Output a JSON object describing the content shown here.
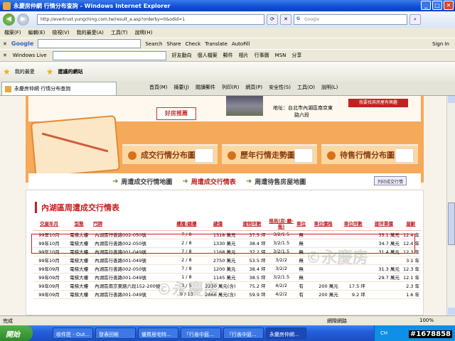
{
  "window": {
    "title": "永慶房仲網 行情分布查詢 - Windows Internet Explorer"
  },
  "address": {
    "url": "http://evertrust.yungching.com.tw/result_a.asp?orderby=0&odid=1",
    "search_placeholder": "Google"
  },
  "menu": [
    "檔案(F)",
    "編輯(E)",
    "檢視(V)",
    "我的最愛(A)",
    "工具(T)",
    "說明(H)"
  ],
  "google_toolbar": {
    "label": "Google",
    "search": "Search",
    "items": [
      "Share",
      "Check",
      "Translate",
      "AutoFill",
      "Sign In"
    ]
  },
  "wl_toolbar": {
    "label": "Windows Live",
    "items": [
      "好友動向",
      "個人檔案",
      "郵件",
      "相片",
      "行事曆",
      "MSN",
      "分享"
    ]
  },
  "favorites": {
    "label": "我的最愛",
    "suggest": "建議的網站"
  },
  "tab": {
    "label": "永慶房仲網 行情分布查詢"
  },
  "commands": [
    "首頁(M)",
    "摘要(J)",
    "閱讀郵件",
    "列印(R)",
    "網頁(P)",
    "安全性(S)",
    "工具(O)",
    "說明(L)"
  ],
  "page": {
    "adv_label": "好房推薦",
    "address_line1": "地址：台北市內湖區南京東",
    "address_line2": "路六段",
    "red_button": "我要找其房屋有興趣",
    "tabs": [
      "成交行情分布圖",
      "歷年行情走勢圖",
      "待售行情分布圖"
    ],
    "links": [
      "周遭成交行情地圖",
      "周遭成交行情表",
      "周遭待售房屋地圖"
    ],
    "print_label": "列印成交行情",
    "section_title": "內湖區周遭成交行情表",
    "columns": [
      "交屋年月",
      "型態",
      "門牌",
      "樓層/總樓",
      "總價",
      "建物坪數",
      "格局(房-廳-衛)",
      "車位",
      "車位價格",
      "車位坪數",
      "建坪單價",
      "屋齡"
    ],
    "rows": [
      [
        "99年10月",
        "電梯大樓",
        "內湖區行善路002-050號",
        "7 / 8",
        "1318 萬元",
        "37.5 坪",
        "3/2/1.5",
        "無",
        "",
        "",
        "35.1 萬元",
        "12.4 年"
      ],
      [
        "99年10月",
        "電梯大樓",
        "內湖區行善路002-050號",
        "2 / 8",
        "1330 萬元",
        "38.4 坪",
        "3/2/1.5",
        "無",
        "",
        "",
        "34.7 萬元",
        "12.4 年"
      ],
      [
        "99年10月",
        "電梯大樓",
        "內湖區行善路001-049號",
        "7 / 8",
        "1168 萬元",
        "37.2 坪",
        "3/2/1.5",
        "無",
        "",
        "",
        "31.4 萬元",
        "12.3 年"
      ],
      [
        "99年10月",
        "電梯大樓",
        "內湖區行善路001-049號",
        "2 / 8",
        "2750 萬元",
        "53.5 坪",
        "3/2/2",
        "無",
        "",
        "",
        "",
        "3.1 年"
      ],
      [
        "99年09月",
        "電梯大樓",
        "內湖區行善路002-050號",
        "7 / 8",
        "1200 萬元",
        "38.4 坪",
        "3/2/2",
        "無",
        "",
        "",
        "31.3 萬元",
        "12.3 年"
      ],
      [
        "99年09月",
        "電梯大樓",
        "內湖區行善路001-049號",
        "1 / 8",
        "1145 萬元",
        "38.5 坪",
        "3/2/1.5",
        "無",
        "",
        "",
        "29.7 萬元",
        "12.1 年"
      ],
      [
        "99年09月",
        "電梯大樓",
        "內湖區南京東路六段152-200號",
        "3 / 5",
        "2230 萬元(含)",
        "75.2 坪",
        "4/2/2",
        "有",
        "200 萬元",
        "17.5 坪",
        "",
        "2.3 年"
      ],
      [
        "99年09月",
        "電梯大樓",
        "內湖區行善路001-049號",
        "9 / 13",
        "2866 萬元(含)",
        "59.9 坪",
        "4/2/2",
        "有",
        "200 萬元",
        "9.2 坪",
        "",
        "1.6 年"
      ]
    ]
  },
  "status": {
    "left": "完成",
    "zone": "網際網路",
    "zoom": "100%"
  },
  "taskbar": {
    "start": "開始",
    "items": [
      "收件匣 - Out...",
      "發表回帳",
      "優質居宅特...",
      "「行善中庭...",
      "「行善中庭...",
      "永慶房仲網..."
    ],
    "lang": "CH",
    "time": "#1678858"
  }
}
